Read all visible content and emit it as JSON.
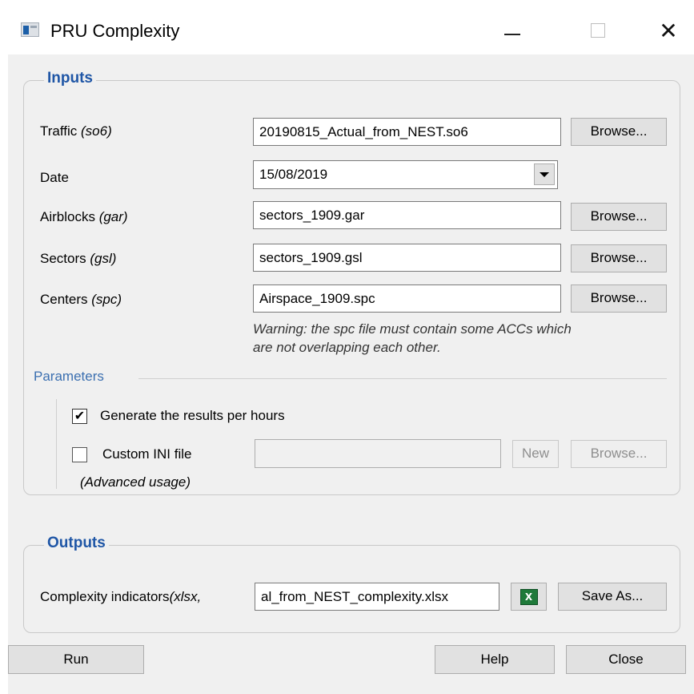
{
  "window": {
    "title": "PRU Complexity",
    "close_glyph": "✕"
  },
  "inputs": {
    "legend": "Inputs",
    "traffic": {
      "label": "Traffic ",
      "ext": "(so6)",
      "value": "20190815_Actual_from_NEST.so6",
      "browse": "Browse..."
    },
    "date": {
      "label": "Date",
      "value": "15/08/2019"
    },
    "airblocks": {
      "label": "Airblocks ",
      "ext": "(gar)",
      "value": "sectors_1909.gar",
      "browse": "Browse..."
    },
    "sectors": {
      "label": "Sectors ",
      "ext": "(gsl)",
      "value": "sectors_1909.gsl",
      "browse": "Browse..."
    },
    "centers": {
      "label": "Centers ",
      "ext": "(spc)",
      "value": "Airspace_1909.spc",
      "browse": "Browse..."
    },
    "warning_line1": "Warning: the spc file must contain some ACCs which",
    "warning_line2": "are not overlapping each other."
  },
  "parameters": {
    "label": "Parameters",
    "per_hours": {
      "label": "Generate the results per hours",
      "checked": true,
      "check_glyph": "✔"
    },
    "custom_ini": {
      "label": "Custom INI file",
      "checked": false,
      "value": "",
      "new": "New",
      "browse": "Browse..."
    },
    "advanced_note": "(Advanced usage)"
  },
  "outputs": {
    "legend": "Outputs",
    "complexity": {
      "label": "Complexity indicators",
      "ext": "(xlsx,",
      "value": "al_from_NEST_complexity.xlsx",
      "xl_glyph": "X",
      "save_as": "Save As..."
    }
  },
  "footer": {
    "run": "Run",
    "help": "Help",
    "close": "Close"
  }
}
